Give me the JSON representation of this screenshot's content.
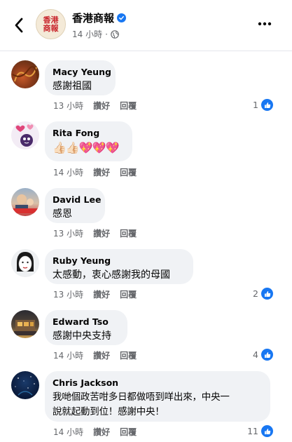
{
  "header": {
    "page_name": "香港商報",
    "logo_line1": "香港",
    "logo_line2": "商報",
    "time": "14 小時",
    "dot": "·"
  },
  "comments": [
    {
      "name": "Macy Yeung",
      "text": "感謝祖國",
      "time": "13 小時",
      "like_label": "讚好",
      "reply_label": "回覆",
      "likes": "1"
    },
    {
      "name": "Rita Fong",
      "text": "👍🏻👍🏻💖💖💖",
      "time": "14 小時",
      "like_label": "讚好",
      "reply_label": "回覆",
      "likes": ""
    },
    {
      "name": "David Lee",
      "text": "感恩",
      "time": "13 小時",
      "like_label": "讚好",
      "reply_label": "回覆",
      "likes": ""
    },
    {
      "name": "Ruby Yeung",
      "text": "太感動，衷心感謝我的母國",
      "time": "13 小時",
      "like_label": "讚好",
      "reply_label": "回覆",
      "likes": "2"
    },
    {
      "name": "Edward Tso",
      "text": "感謝中央支持",
      "time": "14 小時",
      "like_label": "讚好",
      "reply_label": "回覆",
      "likes": "4"
    },
    {
      "name": "Chris Jackson",
      "text_line1": "我哋個政苦咁多日都做唔到咩出來，中央一",
      "text_line2": "說就起動到位！感謝中央！",
      "time": "14 小時",
      "like_label": "讚好",
      "reply_label": "回覆",
      "likes": "11"
    }
  ],
  "colors": {
    "accent": "#1877f2",
    "bubble": "#f0f2f5",
    "meta": "#65676b"
  }
}
